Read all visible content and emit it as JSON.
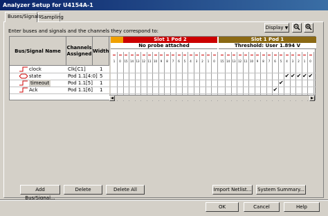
{
  "window": {
    "title": "Analyzer Setup for U4154A-1"
  },
  "tabs": [
    {
      "label": "Buses/Signals"
    },
    {
      "label": "Sampling"
    }
  ],
  "instructions": "Enter buses and signals and the channels they correspond to:",
  "toolbar": {
    "display_label": "Display",
    "zoom_out_icon": "zoom-out-icon",
    "zoom_in_icon": "zoom-in-icon"
  },
  "table": {
    "headers": {
      "name": "Bus/Signal Name",
      "channels": "Channels Assigned",
      "width": "Width"
    },
    "rows": [
      {
        "name": "clock",
        "channels": "Clk[C1]",
        "width": "1"
      },
      {
        "name": "state",
        "channels": "Pod 1.1[4:0]",
        "width": "5"
      },
      {
        "name": "timeout",
        "channels": "Pod 1.1[5]",
        "width": "1"
      },
      {
        "name": "Ack",
        "channels": "Pod 1.1[6]",
        "width": "1"
      }
    ]
  },
  "pods": {
    "slot1pod2": {
      "label": "Slot 1 Pod 2",
      "status": "No probe attached",
      "color": "#cc0000"
    },
    "slot1pod1": {
      "label": "Slot 1 Pod 1",
      "status": "Threshold: User 1.894 V",
      "color": "#8b6914"
    },
    "pod2_columns": [
      "1",
      "0",
      "15",
      "14",
      "13",
      "12",
      "11",
      "10",
      "9",
      "8",
      "7",
      "6",
      "5",
      "4",
      "3",
      "2",
      "1",
      "0"
    ],
    "pod1_columns": [
      "15",
      "14",
      "13",
      "12",
      "11",
      "10",
      "9",
      "8",
      "7",
      "6",
      "5",
      "4",
      "3",
      "2",
      "1",
      "0"
    ]
  },
  "buttons": {
    "add": "Add Bus/Signal...",
    "delete": "Delete",
    "delete_all": "Delete All",
    "import": "Import Netlist...",
    "summary": "System Summary...",
    "ok": "OK",
    "cancel": "Cancel",
    "help": "Help"
  }
}
